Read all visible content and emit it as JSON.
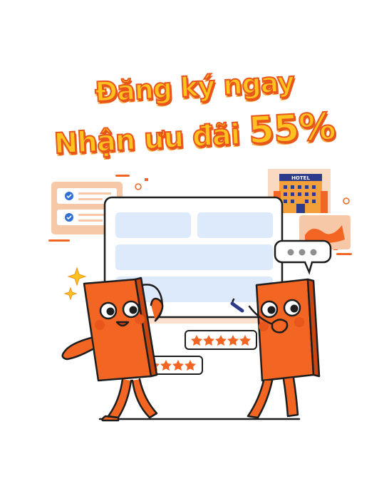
{
  "headline": {
    "line1": "Đăng ký ngay",
    "line2_text": "Nhận ưu đãi ",
    "line2_highlight": "55%"
  },
  "illustration": {
    "hotel_sign": "HOTEL",
    "rating_stars": 5
  },
  "colors": {
    "brand_orange": "#f26522",
    "headline_fill": "#ffc21f",
    "headline_stroke": "#e8561c",
    "panel_blue": "#ddeafb",
    "peach": "#f7c8a8"
  }
}
